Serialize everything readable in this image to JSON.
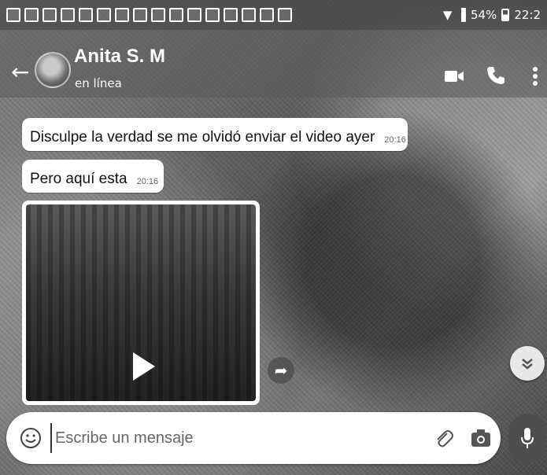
{
  "status_bar": {
    "notification_icons": [
      "facebook-icon",
      "facebook-icon",
      "facebook-icon",
      "gmail-icon",
      "bell-icon",
      "bell-icon",
      "message-icon",
      "map-icon",
      "app-icon",
      "a-icon",
      "check-icon",
      "sync-icon",
      "image-icon",
      "check-icon",
      "image-icon",
      "circle-icon"
    ],
    "battery": "54%",
    "time": "22:2"
  },
  "header": {
    "contact_name": "Anita S. M",
    "contact_status": "en línea"
  },
  "messages": [
    {
      "text": "Disculpe la verdad se me olvidó enviar el video ayer",
      "time": "20:16"
    },
    {
      "text": "Pero aquí esta",
      "time": "20:16"
    }
  ],
  "composer": {
    "placeholder": "Escribe un mensaje"
  },
  "colors": {
    "bubble": "#ffffff",
    "header": "#5a5a5a",
    "mic_button": "#4e4e4e"
  }
}
